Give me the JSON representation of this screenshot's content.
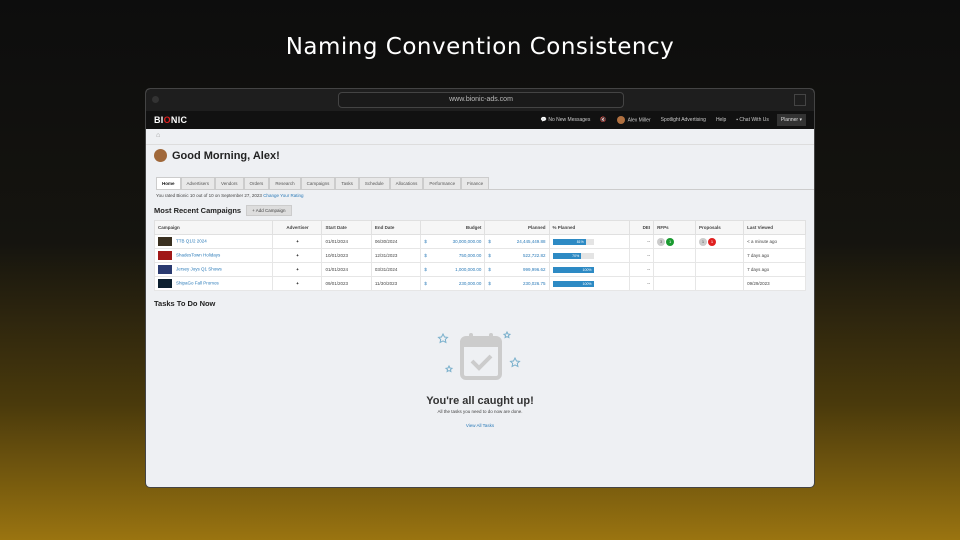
{
  "headline": "Naming Convention Consistency",
  "browser": {
    "url": "www.bionic-ads.com"
  },
  "nav": {
    "logo_pre": "BI",
    "logo_mid": "O",
    "logo_post": "NIC",
    "messages": "No New Messages",
    "user": "Alex Miller",
    "org": "Spotlight Advertising",
    "help": "Help",
    "chat": "Chat With Us",
    "role": "Planner ▾"
  },
  "greeting": "Good Morning, Alex!",
  "tabs": [
    "Home",
    "Advertisers",
    "Vendors",
    "Orders",
    "Research",
    "Campaigns",
    "Tasks",
    "Schedule",
    "Allocations",
    "Performance",
    "Finance"
  ],
  "rating": {
    "text": "You rated Bionic 10 out of 10 on September 27, 2023",
    "link": "Change Your Rating"
  },
  "campaigns": {
    "title": "Most Recent Campaigns",
    "add": "+ Add Campaign",
    "columns": [
      "Campaign",
      "Advertiser",
      "Start Date",
      "End Date",
      "Budget",
      "Planned",
      "% Planned",
      "DEI",
      "RFPs",
      "Proposals",
      "Last Viewed"
    ],
    "rows": [
      {
        "name": "TTB Q1/2 2024",
        "start": "01/01/2024",
        "end": "06/30/2024",
        "budget": "30,000,000.00",
        "planned": "24,445,449.88",
        "pct": 81,
        "pct_label": "81%",
        "dei": "--",
        "rfps": [
          "3",
          "1"
        ],
        "proposals": [
          "1",
          "1"
        ],
        "viewed": "< a minute ago",
        "thumb": "#3a3020"
      },
      {
        "name": "ShadesTown Holidays",
        "start": "10/01/2023",
        "end": "12/31/2023",
        "budget": "750,000.00",
        "planned": "522,722.82",
        "pct": 70,
        "pct_label": "70%",
        "dei": "--",
        "rfps": [],
        "proposals": [],
        "viewed": "7 days ago",
        "thumb": "#a01818"
      },
      {
        "name": "Jersey Joys Q1 Shows",
        "start": "01/01/2024",
        "end": "03/31/2024",
        "budget": "1,000,000.00",
        "planned": "999,996.62",
        "pct": 100,
        "pct_label": "100%",
        "dei": "--",
        "rfps": [],
        "proposals": [],
        "viewed": "7 days ago",
        "thumb": "#2a3a70"
      },
      {
        "name": "ShipaGo Fall Promos",
        "start": "09/01/2023",
        "end": "11/30/2023",
        "budget": "230,000.00",
        "planned": "230,026.75",
        "pct": 100,
        "pct_label": "100%",
        "dei": "--",
        "rfps": [],
        "proposals": [],
        "viewed": "09/29/2023",
        "thumb": "#0d2030"
      }
    ],
    "currency": "$"
  },
  "tasks": {
    "title": "Tasks To Do Now",
    "heading": "You're all caught up!",
    "sub": "All the tasks you need to do now are done.",
    "link": "View All Tasks"
  }
}
